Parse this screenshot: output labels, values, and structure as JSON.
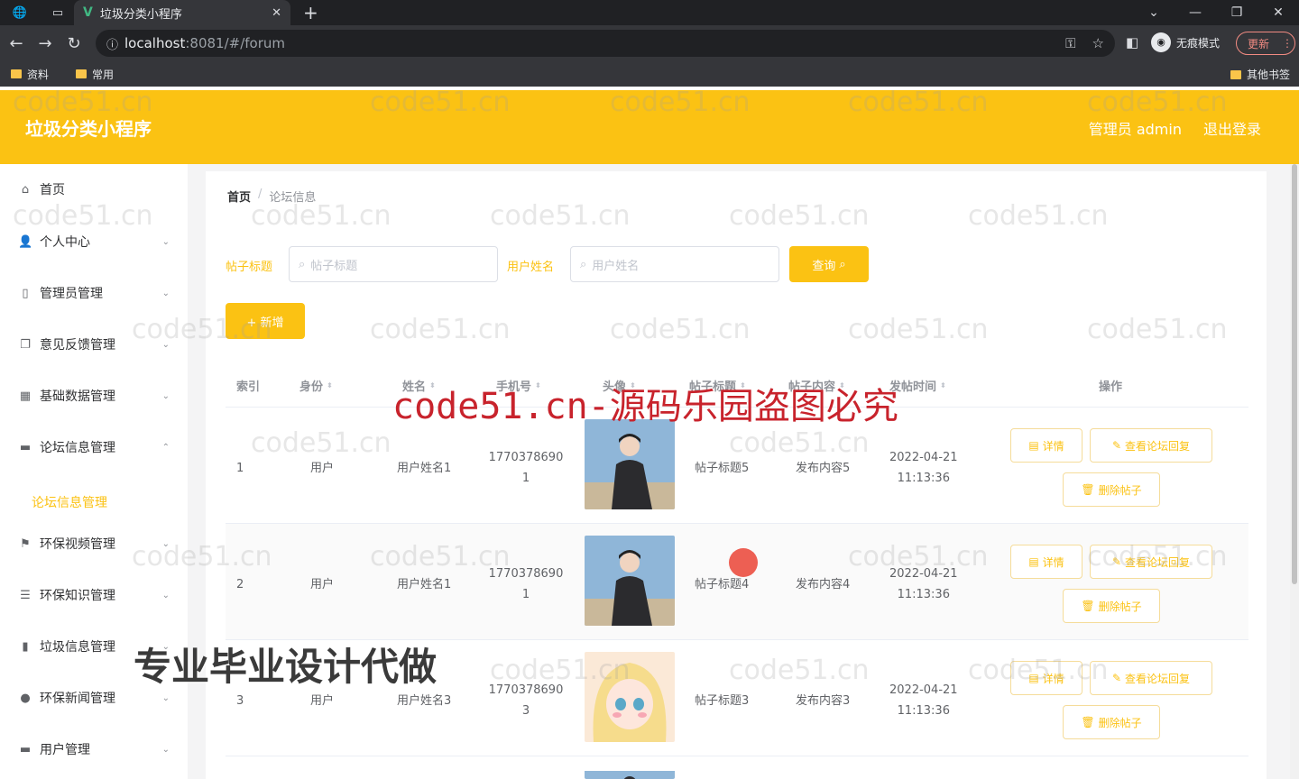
{
  "browser": {
    "tab_title": "垃圾分类小程序",
    "url_host": "localhost",
    "url_rest": ":8081/#/forum",
    "incognito_label": "无痕模式",
    "update_label": "更新",
    "bookmarks": [
      "资料",
      "常用"
    ],
    "other_bookmarks": "其他书签"
  },
  "header": {
    "title": "垃圾分类小程序",
    "user": "管理员 admin",
    "logout": "退出登录"
  },
  "sidebar": {
    "items": [
      {
        "label": "首页",
        "icon": "home-icon"
      },
      {
        "label": "个人中心",
        "icon": "user-icon"
      },
      {
        "label": "管理员管理",
        "icon": "phone-icon"
      },
      {
        "label": "意见反馈管理",
        "icon": "copy-icon"
      },
      {
        "label": "基础数据管理",
        "icon": "grid-icon"
      },
      {
        "label": "论坛信息管理",
        "icon": "monitor-icon"
      },
      {
        "label": "环保视频管理",
        "icon": "flag-icon"
      },
      {
        "label": "环保知识管理",
        "icon": "list-icon"
      },
      {
        "label": "垃圾信息管理",
        "icon": "bar-chart-icon"
      },
      {
        "label": "环保新闻管理",
        "icon": "bulb-icon"
      },
      {
        "label": "用户管理",
        "icon": "message-icon"
      }
    ],
    "active_sub": "论坛信息管理"
  },
  "breadcrumb": {
    "home": "首页",
    "current": "论坛信息"
  },
  "filters": {
    "title_label": "帖子标题",
    "title_placeholder": "帖子标题",
    "name_label": "用户姓名",
    "name_placeholder": "用户姓名",
    "query_label": "查询",
    "add_label": "+ 新增"
  },
  "table": {
    "headers": [
      "索引",
      "身份",
      "姓名",
      "手机号",
      "头像",
      "帖子标题",
      "帖子内容",
      "发帖时间",
      "操作"
    ],
    "rows": [
      {
        "index": "1",
        "role": "用户",
        "name": "用户姓名1",
        "phone1": "1770378690",
        "phone2": "1",
        "title": "帖子标题5",
        "content": "发布内容5",
        "date": "2022-04-21",
        "time": "11:13:36"
      },
      {
        "index": "2",
        "role": "用户",
        "name": "用户姓名1",
        "phone1": "1770378690",
        "phone2": "1",
        "title": "帖子标题4",
        "content": "发布内容4",
        "date": "2022-04-21",
        "time": "11:13:36"
      },
      {
        "index": "3",
        "role": "用户",
        "name": "用户姓名3",
        "phone1": "1770378690",
        "phone2": "3",
        "title": "帖子标题3",
        "content": "发布内容3",
        "date": "2022-04-21",
        "time": "11:13:36"
      }
    ],
    "actions": {
      "detail": "详情",
      "view_reply": "查看论坛回复",
      "delete": "删除帖子"
    }
  },
  "watermarks": {
    "small": "code51.cn",
    "big": "code51.cn-源码乐园盗图必究",
    "ad": "专业毕业设计代做"
  },
  "colors": {
    "accent": "#fbc213",
    "chrome": "#35363a"
  }
}
